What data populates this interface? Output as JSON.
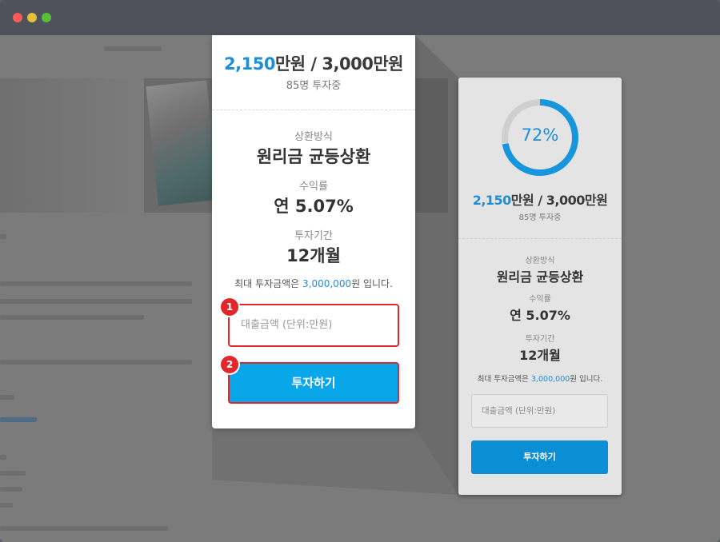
{
  "window": {
    "controls": [
      "close",
      "minimize",
      "maximize"
    ]
  },
  "colors": {
    "accent": "#1e8fd6",
    "button": "#0aa6ea",
    "highlight": "#e3262a"
  },
  "card": {
    "raised_amount": "2,150",
    "raised_unit": "만원",
    "separator": " / ",
    "target_amount": "3,000만원",
    "investors": "85명 투자중",
    "progress_percent": "72%",
    "progress_value": 0.72,
    "repayment_label": "상환방식",
    "repayment_value": "원리금 균등상환",
    "yield_label": "수익률",
    "yield_value": "연 5.07%",
    "period_label": "투자기간",
    "period_value": "12개월",
    "max_prefix": "최대 투자금액은 ",
    "max_amount": "3,000,000",
    "max_suffix": "원 입니다.",
    "input_placeholder": "대출금액 (단위:만원)",
    "invest_button": "투자하기"
  },
  "badges": {
    "first": "1",
    "second": "2"
  }
}
